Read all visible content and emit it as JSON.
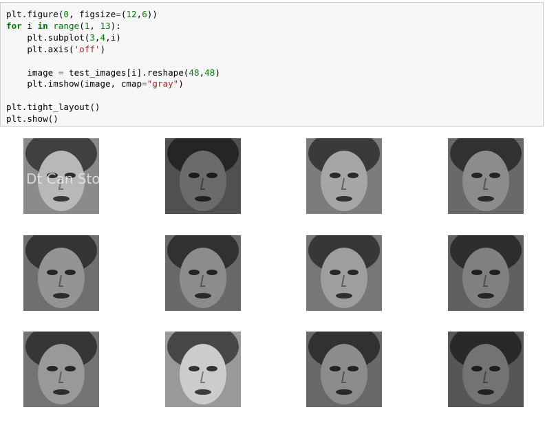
{
  "code_cell": {
    "lines": [
      [
        {
          "t": "plt.figure(",
          "c": "plain"
        },
        {
          "t": "0",
          "c": "num"
        },
        {
          "t": ", figsize",
          "c": "plain"
        },
        {
          "t": "=",
          "c": "op"
        },
        {
          "t": "(",
          "c": "plain"
        },
        {
          "t": "12",
          "c": "num"
        },
        {
          "t": ",",
          "c": "plain"
        },
        {
          "t": "6",
          "c": "num"
        },
        {
          "t": "))",
          "c": "plain"
        }
      ],
      [
        {
          "t": "for",
          "c": "kw"
        },
        {
          "t": " i ",
          "c": "plain"
        },
        {
          "t": "in",
          "c": "kw"
        },
        {
          "t": " ",
          "c": "plain"
        },
        {
          "t": "range",
          "c": "bi"
        },
        {
          "t": "(",
          "c": "plain"
        },
        {
          "t": "1",
          "c": "num"
        },
        {
          "t": ", ",
          "c": "plain"
        },
        {
          "t": "13",
          "c": "num"
        },
        {
          "t": "):",
          "c": "plain"
        }
      ],
      [
        {
          "t": "    plt.subplot(",
          "c": "plain"
        },
        {
          "t": "3",
          "c": "num"
        },
        {
          "t": ",",
          "c": "plain"
        },
        {
          "t": "4",
          "c": "num"
        },
        {
          "t": ",i)",
          "c": "plain"
        }
      ],
      [
        {
          "t": "    plt.axis(",
          "c": "plain"
        },
        {
          "t": "'off'",
          "c": "str"
        },
        {
          "t": ")",
          "c": "plain"
        }
      ],
      [],
      [
        {
          "t": "    image ",
          "c": "plain"
        },
        {
          "t": "=",
          "c": "op"
        },
        {
          "t": " test_images[i].reshape(",
          "c": "plain"
        },
        {
          "t": "48",
          "c": "num"
        },
        {
          "t": ",",
          "c": "plain"
        },
        {
          "t": "48",
          "c": "num"
        },
        {
          "t": ")",
          "c": "plain"
        }
      ],
      [
        {
          "t": "    plt.imshow(image, cmap",
          "c": "plain"
        },
        {
          "t": "=",
          "c": "op"
        },
        {
          "t": "\"gray\"",
          "c": "str"
        },
        {
          "t": ")",
          "c": "plain"
        }
      ],
      [],
      [
        {
          "t": "plt.tight_layout()",
          "c": "plain"
        }
      ],
      [
        {
          "t": "plt.show()",
          "c": "plain"
        }
      ]
    ]
  },
  "colors": {
    "cell_background": "#f7f7f7",
    "cell_border": "#cfcfcf",
    "keyword": "#008000",
    "number": "#008000",
    "string": "#ba2121",
    "operator": "#666666"
  },
  "output_images": {
    "cmap": "gray",
    "rows": 3,
    "cols": 4,
    "items": [
      {
        "label": "face-1",
        "tone": 0.72,
        "watermark": "Dt Can Sto"
      },
      {
        "label": "face-2",
        "tone": 0.42,
        "watermark": ""
      },
      {
        "label": "face-3",
        "tone": 0.65,
        "watermark": ""
      },
      {
        "label": "face-4",
        "tone": 0.55,
        "watermark": ""
      },
      {
        "label": "face-5",
        "tone": 0.58,
        "watermark": ""
      },
      {
        "label": "face-6",
        "tone": 0.55,
        "watermark": ""
      },
      {
        "label": "face-7",
        "tone": 0.62,
        "watermark": ""
      },
      {
        "label": "face-8",
        "tone": 0.5,
        "watermark": ""
      },
      {
        "label": "face-9",
        "tone": 0.6,
        "watermark": ""
      },
      {
        "label": "face-10",
        "tone": 0.8,
        "watermark": ""
      },
      {
        "label": "face-11",
        "tone": 0.55,
        "watermark": ""
      },
      {
        "label": "face-12",
        "tone": 0.45,
        "watermark": ""
      }
    ]
  }
}
